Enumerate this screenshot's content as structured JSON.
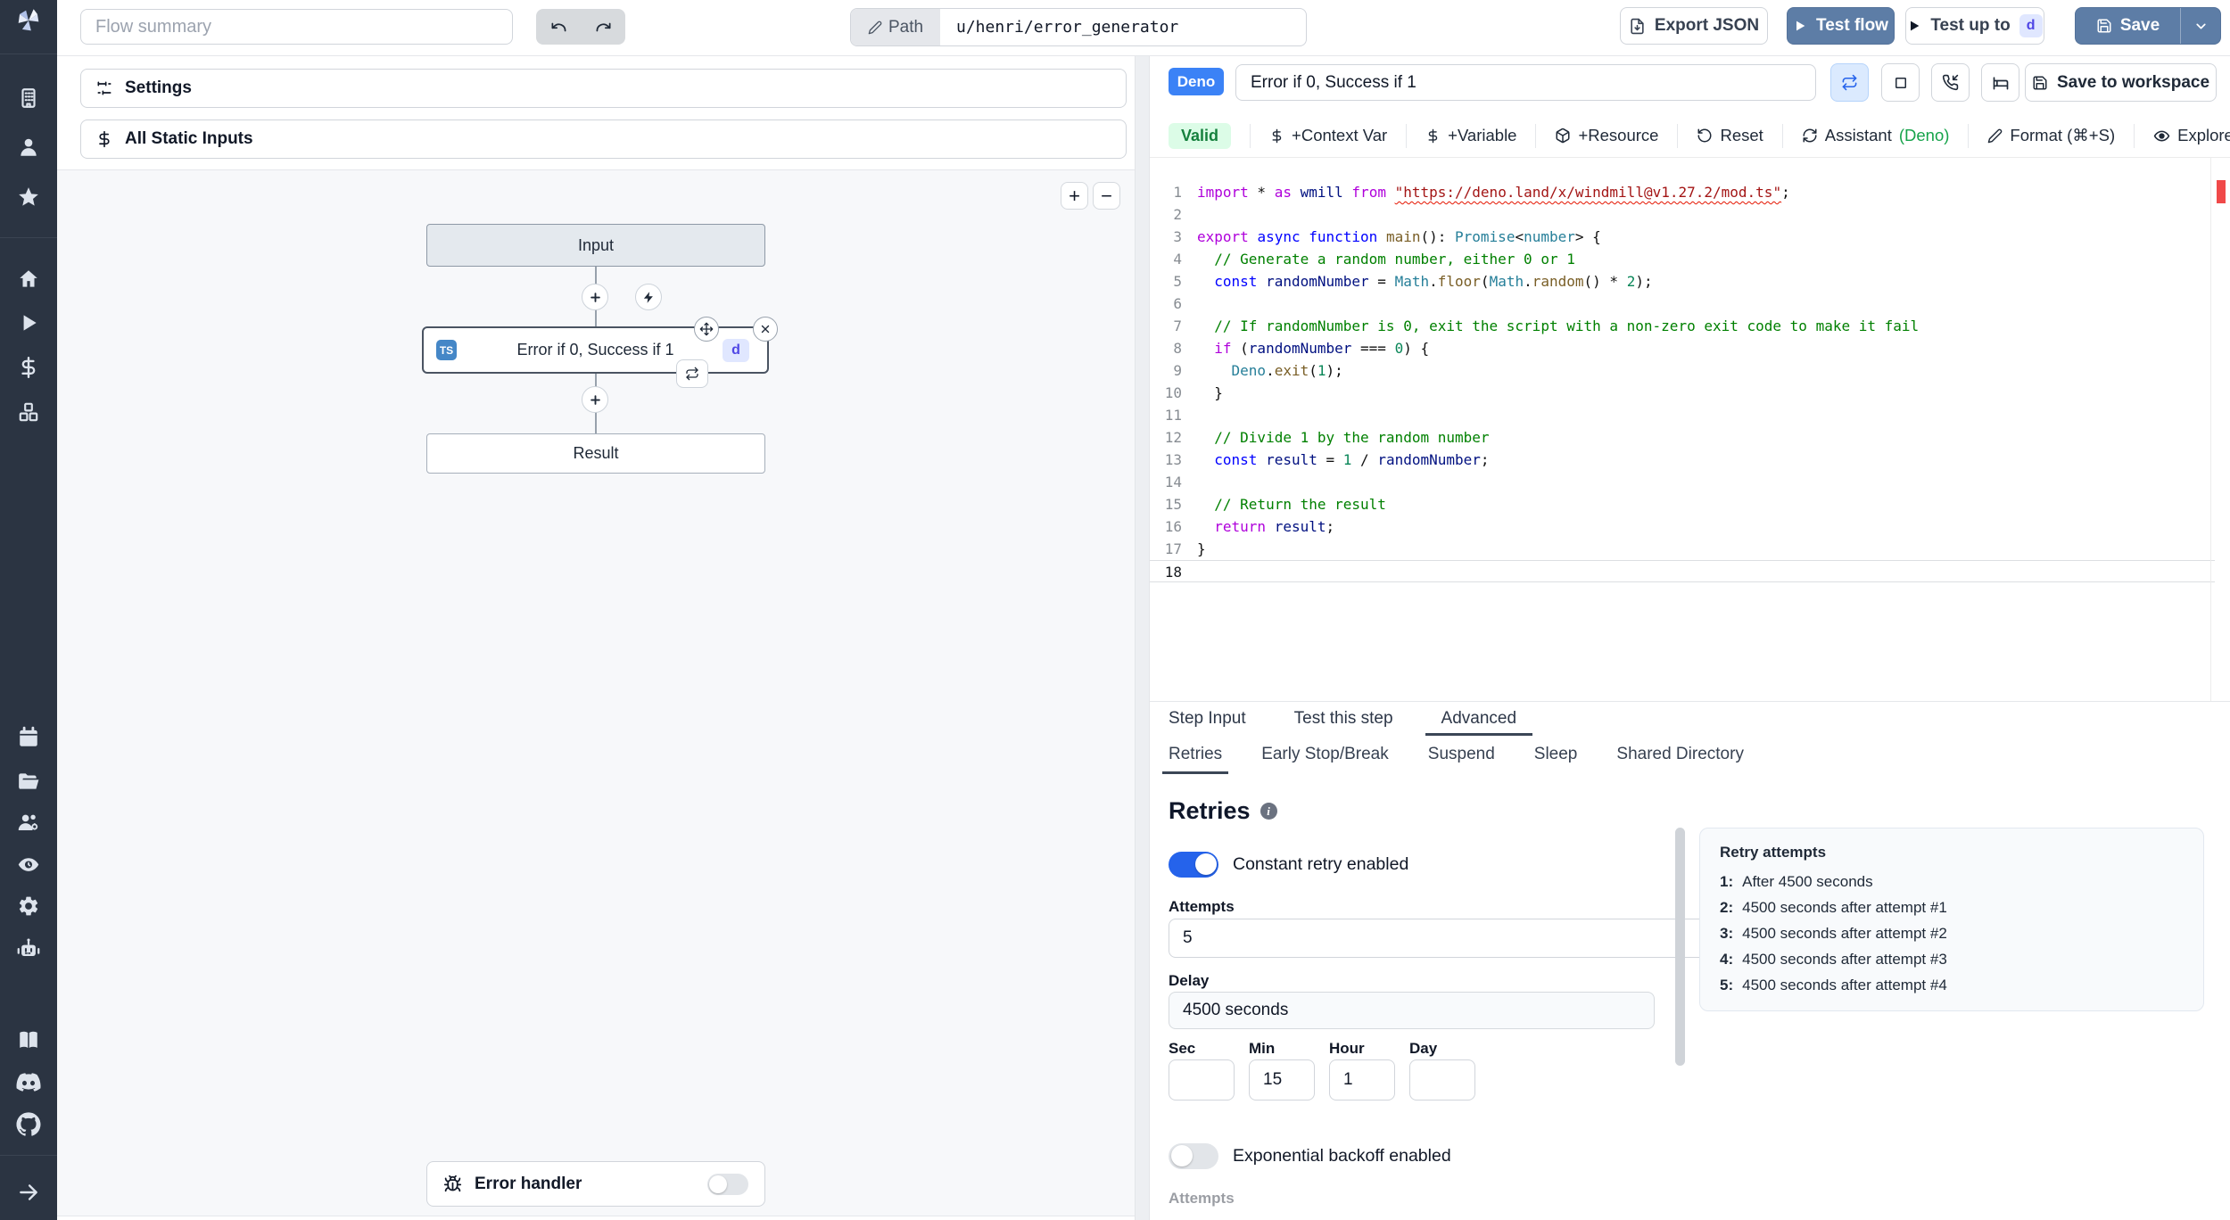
{
  "header": {
    "flow_summary_placeholder": "Flow summary",
    "path_label": "Path",
    "path_value": "u/henri/error_generator",
    "export_json": "Export JSON",
    "test_flow": "Test flow",
    "test_up_to": "Test up to",
    "test_up_to_badge": "d",
    "save": "Save"
  },
  "sidebar": {
    "icons": [
      "windmill-logo",
      "workspace",
      "user",
      "favorites",
      "home",
      "runs",
      "variables",
      "resources",
      "schedules",
      "folders",
      "groups",
      "audit-logs",
      "settings",
      "workers",
      "docs",
      "discord",
      "github",
      "collapse"
    ]
  },
  "flow_panel": {
    "settings": "Settings",
    "all_static_inputs": "All Static Inputs",
    "zoom_in": "+",
    "zoom_out": "−",
    "input_node": "Input",
    "step_node": {
      "lang": "TS",
      "title": "Error if 0, Success if 1",
      "badge": "d"
    },
    "result_node": "Result",
    "error_handler": "Error handler"
  },
  "step_panel": {
    "lang_badge": "Deno",
    "name": "Error if 0, Success if 1",
    "save_to_workspace": "Save to workspace",
    "toolbar": {
      "valid": "Valid",
      "context_var": "+Context Var",
      "variable": "+Variable",
      "resource": "+Resource",
      "reset": "Reset",
      "assistant": "Assistant",
      "assistant_lang": "(Deno)",
      "format": "Format (⌘+S)",
      "explore": "Explore other s"
    },
    "tabs": [
      "Step Input",
      "Test this step",
      "Advanced"
    ],
    "subtabs": [
      "Retries",
      "Early Stop/Break",
      "Suspend",
      "Sleep",
      "Shared Directory"
    ],
    "retries": {
      "heading": "Retries",
      "constant_label": "Constant retry enabled",
      "attempts_label": "Attempts",
      "attempts_value": "5",
      "delay_label": "Delay",
      "delay_value": "4500 seconds",
      "sec_label": "Sec",
      "min_label": "Min",
      "hour_label": "Hour",
      "day_label": "Day",
      "sec_value": "",
      "min_value": "15",
      "hour_value": "1",
      "day_value": "",
      "exponential_label": "Exponential backoff enabled",
      "next_section_label": "Attempts"
    },
    "retry_preview": {
      "title": "Retry attempts",
      "items": [
        {
          "n": "1:",
          "t": "After 4500 seconds"
        },
        {
          "n": "2:",
          "t": "4500 seconds after attempt #1"
        },
        {
          "n": "3:",
          "t": "4500 seconds after attempt #2"
        },
        {
          "n": "4:",
          "t": "4500 seconds after attempt #3"
        },
        {
          "n": "5:",
          "t": "4500 seconds after attempt #4"
        }
      ]
    }
  },
  "editor": {
    "language": "typescript",
    "lines": [
      {
        "tokens": [
          [
            "import",
            "c"
          ],
          [
            " * ",
            "d"
          ],
          [
            "as",
            "c"
          ],
          [
            " ",
            "d"
          ],
          [
            "wmill",
            "v"
          ],
          [
            " ",
            "d"
          ],
          [
            "from",
            "c"
          ],
          [
            " ",
            "d"
          ],
          [
            "\"https://deno.land/x/windmill@v1.27.2/mod.ts\"",
            "u"
          ],
          [
            ";",
            "d"
          ]
        ]
      },
      {
        "tokens": []
      },
      {
        "tokens": [
          [
            "export",
            "c"
          ],
          [
            " ",
            "d"
          ],
          [
            "async",
            "k"
          ],
          [
            " ",
            "d"
          ],
          [
            "function",
            "k"
          ],
          [
            " ",
            "d"
          ],
          [
            "main",
            "f"
          ],
          [
            "(): ",
            "d"
          ],
          [
            "Promise",
            "t"
          ],
          [
            "<",
            "d"
          ],
          [
            "number",
            "t"
          ],
          [
            "> {",
            "d"
          ]
        ]
      },
      {
        "tokens": [
          [
            "  // Generate a random number, either 0 or 1",
            "m"
          ]
        ]
      },
      {
        "tokens": [
          [
            "  ",
            "d"
          ],
          [
            "const",
            "k"
          ],
          [
            " ",
            "d"
          ],
          [
            "randomNumber",
            "v"
          ],
          [
            " = ",
            "d"
          ],
          [
            "Math",
            "t"
          ],
          [
            ".",
            "d"
          ],
          [
            "floor",
            "f"
          ],
          [
            "(",
            "d"
          ],
          [
            "Math",
            "t"
          ],
          [
            ".",
            "d"
          ],
          [
            "random",
            "f"
          ],
          [
            "() * ",
            "d"
          ],
          [
            "2",
            "n"
          ],
          [
            ");",
            "d"
          ]
        ]
      },
      {
        "tokens": []
      },
      {
        "tokens": [
          [
            "  // If randomNumber is 0, exit the script with a non-zero exit code to make it fail",
            "m"
          ]
        ]
      },
      {
        "tokens": [
          [
            "  ",
            "d"
          ],
          [
            "if",
            "c"
          ],
          [
            " (",
            "d"
          ],
          [
            "randomNumber",
            "v"
          ],
          [
            " === ",
            "d"
          ],
          [
            "0",
            "n"
          ],
          [
            ") {",
            "d"
          ]
        ]
      },
      {
        "tokens": [
          [
            "    ",
            "d"
          ],
          [
            "Deno",
            "t"
          ],
          [
            ".",
            "d"
          ],
          [
            "exit",
            "f"
          ],
          [
            "(",
            "d"
          ],
          [
            "1",
            "n"
          ],
          [
            ");",
            "d"
          ]
        ]
      },
      {
        "tokens": [
          [
            "  }",
            "d"
          ]
        ]
      },
      {
        "tokens": []
      },
      {
        "tokens": [
          [
            "  // Divide 1 by the random number",
            "m"
          ]
        ]
      },
      {
        "tokens": [
          [
            "  ",
            "d"
          ],
          [
            "const",
            "k"
          ],
          [
            " ",
            "d"
          ],
          [
            "result",
            "v"
          ],
          [
            " = ",
            "d"
          ],
          [
            "1",
            "n"
          ],
          [
            " / ",
            "d"
          ],
          [
            "randomNumber",
            "v"
          ],
          [
            ";",
            "d"
          ]
        ]
      },
      {
        "tokens": []
      },
      {
        "tokens": [
          [
            "  // Return the result",
            "m"
          ]
        ]
      },
      {
        "tokens": [
          [
            "  ",
            "d"
          ],
          [
            "return",
            "c"
          ],
          [
            " ",
            "d"
          ],
          [
            "result",
            "v"
          ],
          [
            ";",
            "d"
          ]
        ]
      },
      {
        "tokens": [
          [
            "}",
            "d"
          ]
        ]
      },
      {
        "tokens": [],
        "current": true
      }
    ]
  },
  "colors": {
    "accent_blue": "#5d7da6",
    "deno_badge": "#3b82f6",
    "ts_badge": "#4587c7",
    "toggle_on": "#2563eb",
    "valid_bg": "#dcfce7",
    "valid_text": "#15803d",
    "assistant_green": "#16a34a",
    "sidebar_bg": "#2b3442",
    "error_marker": "#f04949"
  }
}
